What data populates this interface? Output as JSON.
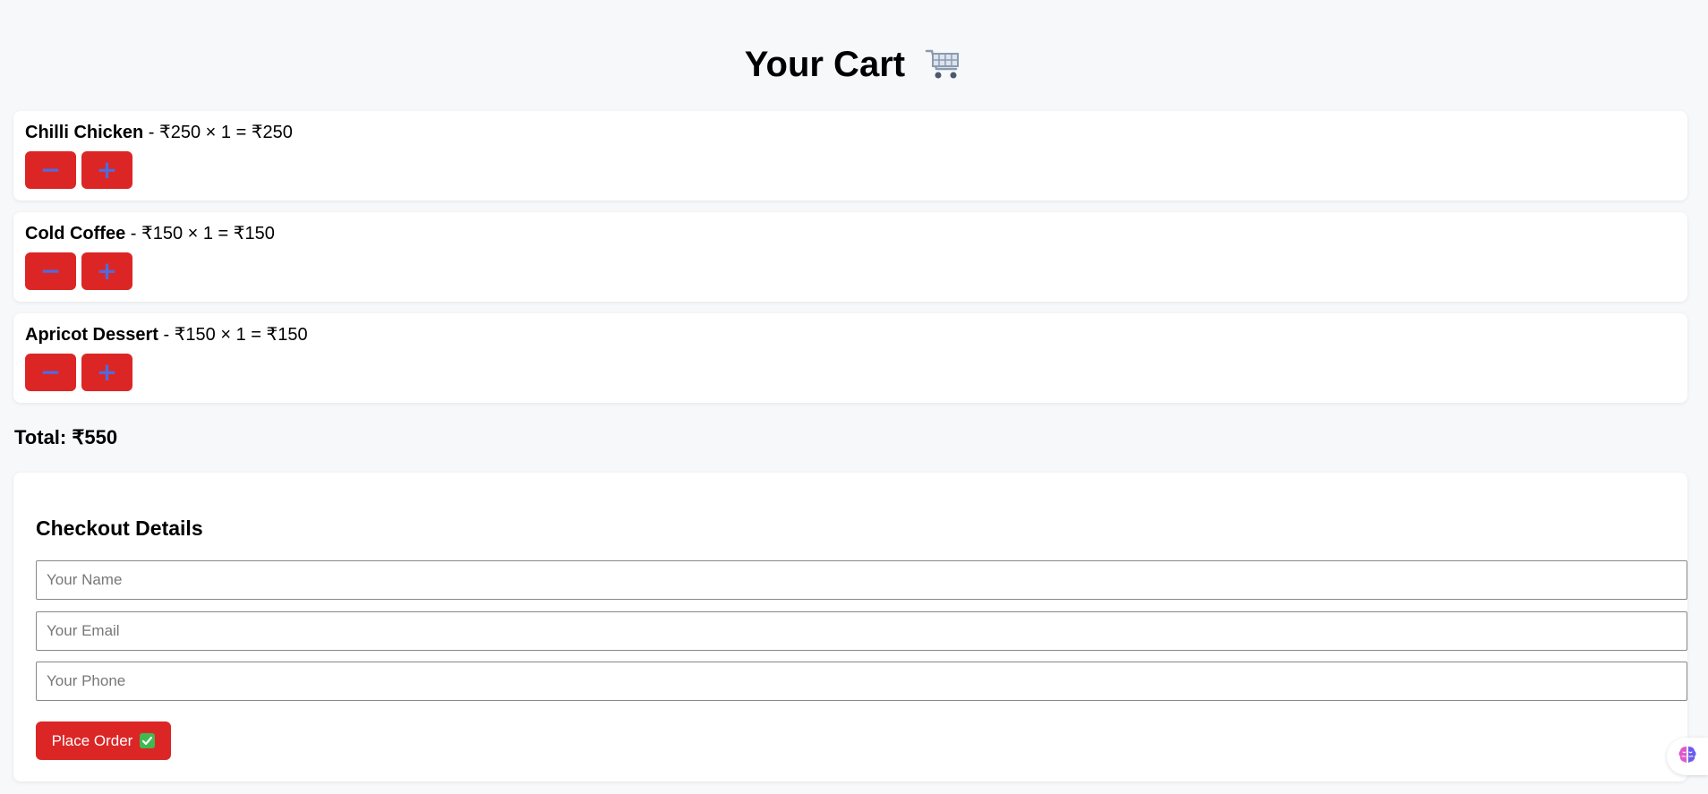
{
  "header": {
    "title": "Your Cart",
    "icon": "shopping-cart-icon"
  },
  "cart": {
    "items": [
      {
        "name": "Chilli Chicken",
        "detail": " - ₹250 × 1 = ₹250",
        "decrease_label": "−",
        "increase_label": "+"
      },
      {
        "name": "Cold Coffee",
        "detail": " - ₹150 × 1 = ₹150",
        "decrease_label": "−",
        "increase_label": "+"
      },
      {
        "name": "Apricot Dessert",
        "detail": " - ₹150 × 1 = ₹150",
        "decrease_label": "−",
        "increase_label": "+"
      }
    ],
    "total_label": "Total: ₹550"
  },
  "checkout": {
    "title": "Checkout Details",
    "name_placeholder": "Your Name",
    "email_placeholder": "Your Email",
    "phone_placeholder": "Your Phone",
    "name_value": "",
    "email_value": "",
    "phone_value": "",
    "place_order_label": "Place Order",
    "place_order_icon": "check-mark-icon"
  },
  "floating_button": {
    "icon": "brain-icon"
  },
  "colors": {
    "accent": "#dc2626",
    "button_glyph": "#4f6bdc",
    "background": "#f7f8fa",
    "card": "#ffffff",
    "check": "#3fb950"
  }
}
